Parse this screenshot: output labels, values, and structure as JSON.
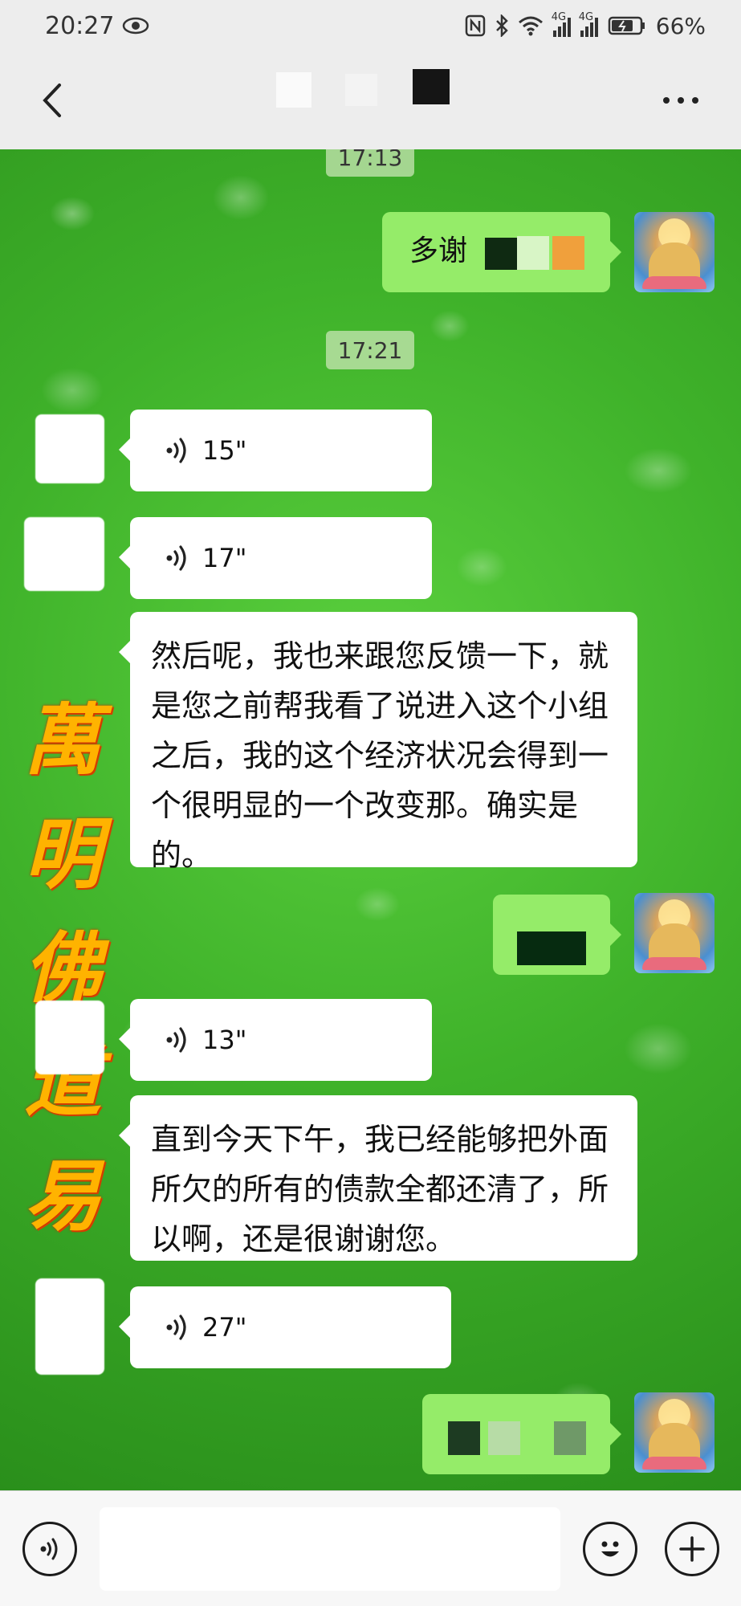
{
  "status_bar": {
    "time": "20:27",
    "battery": "66%",
    "network_1": "4G",
    "network_2": "4G"
  },
  "nav": {
    "back_icon": "chevron-left-icon",
    "more_icon": "more-dots-icon",
    "more_label": "···"
  },
  "watermark": {
    "chars": [
      "萬",
      "明",
      "佛",
      "道",
      "易"
    ]
  },
  "messages": {
    "time_1": "17:13",
    "out_1": "多谢",
    "time_2": "17:21",
    "voice_1": "15\"",
    "voice_2": "17\"",
    "text_1": "然后呢，我也来跟您反馈一下，就是您之前帮我看了说进入这个小组之后，我的这个经济状况会得到一个很明显的一个改变那。确实是的。",
    "voice_3": "13\"",
    "text_2": "直到今天下午，我已经能够把外面所欠的所有的债款全都还清了，所以啊，还是很谢谢您。",
    "voice_4": "27\""
  },
  "colors": {
    "chat_green": "#3fb22a",
    "bubble_out": "#95ec69",
    "bubble_in": "#ffffff",
    "watermark": "#ffb300"
  },
  "input_bar": {
    "voice_icon": "voice-toggle-icon",
    "emoji_icon": "emoji-icon",
    "add_icon": "plus-icon"
  }
}
